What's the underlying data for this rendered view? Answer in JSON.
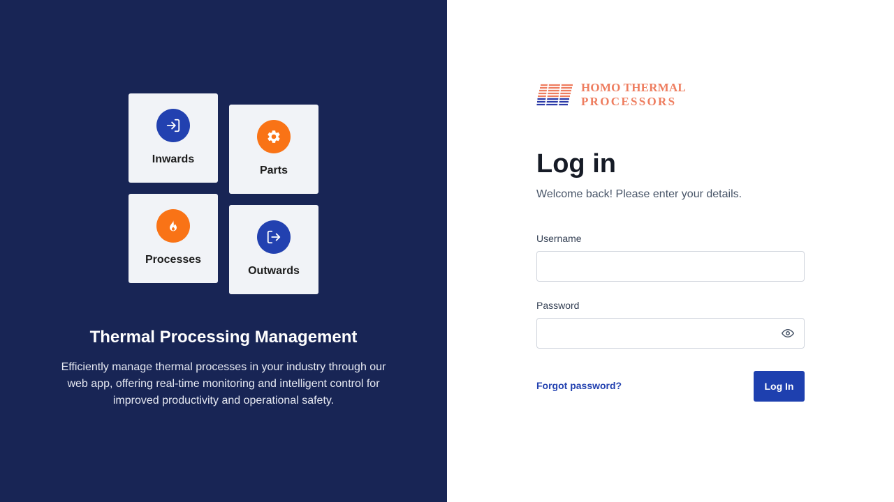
{
  "colors": {
    "left_panel_bg": "#182555",
    "tile_bg": "#f1f3f7",
    "accent_blue": "#1e40af",
    "accent_orange": "#f97316",
    "logo_color": "#ee7d5f"
  },
  "tiles": [
    {
      "label": "Inwards",
      "icon": "log-in-icon",
      "color": "blue"
    },
    {
      "label": "Parts",
      "icon": "gear-icon",
      "color": "orange"
    },
    {
      "label": "Processes",
      "icon": "flame-icon",
      "color": "orange"
    },
    {
      "label": "Outwards",
      "icon": "log-out-icon",
      "color": "blue"
    }
  ],
  "hero": {
    "title": "Thermal Processing Management",
    "description": "Efficiently manage thermal processes in your industry through our web app, offering real-time monitoring and intelligent control for improved productivity and operational safety."
  },
  "logo": {
    "line1": "HOMO THERMAL",
    "line2": "PROCESSORS"
  },
  "login": {
    "title": "Log in",
    "subtitle": "Welcome back! Please enter your details.",
    "username_label": "Username",
    "username_value": "",
    "password_label": "Password",
    "password_value": "",
    "password_toggle_icon": "eye-icon",
    "forgot_label": "Forgot password?",
    "submit_label": "Log In"
  }
}
